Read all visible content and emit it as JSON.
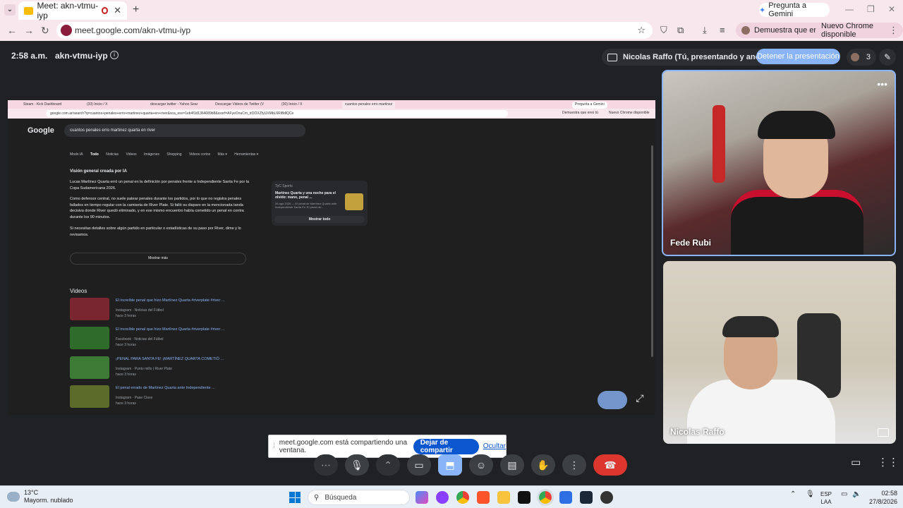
{
  "browser": {
    "tab_title": "Meet: akn-vtmu-iyp",
    "new_tab": "+",
    "gemini_button": "Pregunta a Gemini",
    "url": "meet.google.com/akn-vtmu-iyp",
    "verify_pill": "Demuestra que eres tú",
    "update_pill": "Nuevo Chrome disponible",
    "colors": {
      "frame": "#f9e7ee",
      "accent": "#0b57d0"
    }
  },
  "meet": {
    "time": "2:58 a.m.",
    "code": "akn-vtmu-iyp",
    "presenting_text": "Nicolas Raffo (Tú, presentando y anotando)",
    "stop_presenting": "Detener la presentación",
    "participants_count": "3"
  },
  "shared_screen": {
    "tabs": [
      "Steam - Kick Dashboard",
      "(33) Inicio / X",
      "descargar twitter - Yahoo Sear",
      "Descargar Videos de Twitter (V",
      "(30) Inicio / X",
      "cuantos penales erro martinez"
    ],
    "gemini": "Pregunta a Gemini",
    "url": "google.com.ar/search?q=cuantos+penales+erro+martinez+quarta+en+river&sca_esv=1eb4f1d1364089b8&sxsrf=AFyeOnuCm_trDOXZfyUXMbL6RiBdlQCe",
    "verify": "Demuestra que eres tú",
    "update": "Nuevo Chrome disponible",
    "logo": "Google",
    "query": "cuantos penales erro martinez quarta en river",
    "filters": [
      "Modo IA",
      "Todo",
      "Noticias",
      "Videos",
      "Imágenes",
      "Shopping",
      "Videos cortos",
      "Más ▾",
      "Herramientas ▾"
    ],
    "ai_heading": "Visión general creada por IA",
    "ai_p1": "Lucas Martínez Quarta erró un penal en la definición por penales frente a Independiente Santa Fe por la Copa Sudamericana 2026.",
    "ai_p2": "Como defensor central, no suele patear penales durante los partidos, por lo que no registra penales fallados en tiempo regular con la camiseta de River Plate. Si falló su disparo en la mencionada tanda decisiva donde River quedó eliminado, y en ese mismo encuentro había cometido un penal en contra durante los 90 minutos.",
    "ai_p3": "Si necesitas detalles sobre algún partido en particular o estadísticas de su paso por River, dime y lo revisamos.",
    "card_source": "TyC Sports",
    "card_title": "Martínez Quarta y una noche para el olvido: mano, penal ...",
    "card_meta": "26 ago 2026 — El penal de Martínez Quarta ante Independiente Santa Fe: El penal de...",
    "card_button": "Mostrar todo",
    "show_more": "Mostrar más",
    "videos_heading": "Videos",
    "videos": [
      {
        "title": "El increíble penal que hizo Martínez Quarta #riverplate #river ...",
        "source": "Instagram · Noticias del Fútbol",
        "age": "hace 3 horas"
      },
      {
        "title": "El increíble penal que hizo Martínez Quarta #riverplate #river ...",
        "source": "Facebook · Noticias del Fútbol",
        "age": "hace 3 horas"
      },
      {
        "title": "¡PENAL PARA SANTA FE! ¡MARTÍNEZ QUARTA COMETIÓ ...",
        "source": "Instagram · Punto millo | River Plate",
        "age": "hace 3 horas"
      },
      {
        "title": "El penal errado de Martinez Quarta ante Independiente ...",
        "source": "Instagram · Pase Clave",
        "age": "hace 3 horas"
      }
    ]
  },
  "participants": {
    "tile1_name": "Fede Rubi",
    "tile2_name": "Nicolas Raffo"
  },
  "share_notice": {
    "text": "meet.google.com está compartiendo una ventana.",
    "stop_button": "Dejar de compartir",
    "hide_link": "Ocultar"
  },
  "taskbar": {
    "temperature": "13°C",
    "weather": "Mayorm. nublado",
    "search_placeholder": "Búsqueda",
    "lang_top": "ESP",
    "lang_bottom": "LAA",
    "time": "02:58",
    "date": "27/8/2026"
  }
}
